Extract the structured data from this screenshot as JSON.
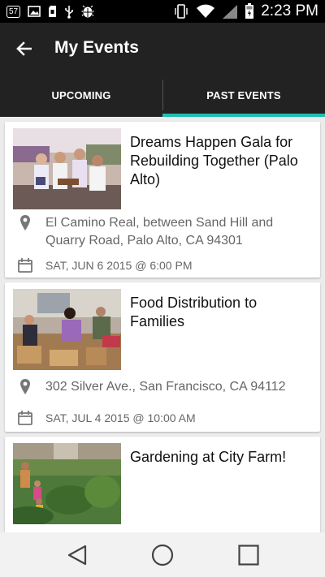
{
  "status_bar": {
    "time": "2:23 PM",
    "notification_badge": "57",
    "left_icons": [
      "notification-badge-icon",
      "image-icon",
      "sd-card-icon",
      "usb-icon",
      "android-debug-icon"
    ],
    "right_icons": [
      "vibrate-icon",
      "wifi-icon",
      "signal-icon",
      "battery-icon"
    ]
  },
  "app_bar": {
    "title": "My Events"
  },
  "tabs": [
    {
      "label": "UPCOMING",
      "active": false
    },
    {
      "label": "PAST EVENTS",
      "active": true
    }
  ],
  "colors": {
    "accent": "#1fbfb0",
    "appbar": "#222222"
  },
  "events": [
    {
      "title": "Dreams Happen Gala for Rebuilding Together (Palo Alto)",
      "location": "El Camino Real, between Sand Hill and Quarry Road, Palo Alto, CA 94301",
      "date": "SAT, JUN 6 2015 @ 6:00 PM"
    },
    {
      "title": "Food Distribution to Families",
      "location": "302 Silver Ave., San Francisco, CA 94112",
      "date": "SAT, JUL 4 2015 @ 10:00 AM"
    },
    {
      "title": "Gardening at City Farm!",
      "location": "",
      "date": ""
    }
  ],
  "nav_bar": {
    "buttons": [
      "back-nav-icon",
      "home-nav-icon",
      "recents-nav-icon"
    ]
  }
}
